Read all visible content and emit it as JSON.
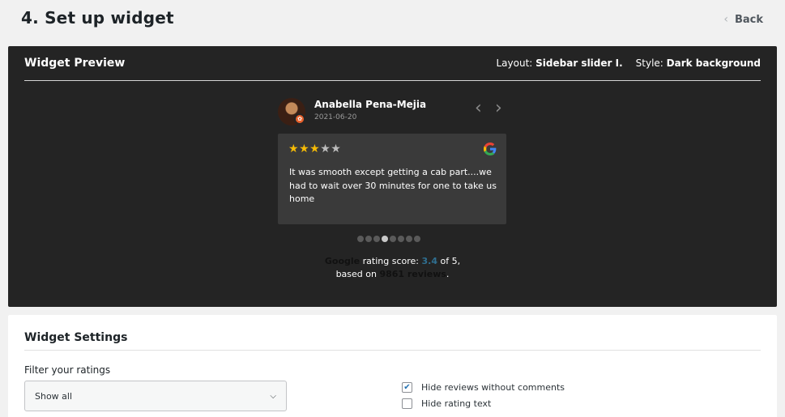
{
  "page": {
    "title": "4. Set up widget",
    "back_label": "Back"
  },
  "preview": {
    "title": "Widget Preview",
    "layout_label": "Layout:",
    "layout_value": "Sidebar slider I.",
    "style_label": "Style:",
    "style_value": "Dark background",
    "review": {
      "name": "Anabella Pena-Mejia",
      "date": "2021-06-20",
      "rating": 3,
      "max_rating": 5,
      "text": "It was smooth except getting a cab part....we had to wait over 30 minutes for one to take us home"
    },
    "pagination": {
      "count": 8,
      "active_index": 3
    },
    "summary": {
      "source": "Google",
      "label": "rating score:",
      "score": "3.4",
      "of": "of 5,",
      "based_on": "based on",
      "reviews": "9861 reviews",
      "end": "."
    },
    "colors": {
      "star_on": "#f6bb06",
      "star_off": "#bdbdbd",
      "panel_bg": "#242424",
      "card_bg": "#3a3a3a"
    }
  },
  "settings": {
    "title": "Widget Settings",
    "filter_label": "Filter your ratings",
    "filter_value": "Show all",
    "options": [
      {
        "label": "Hide reviews without comments",
        "checked": true
      },
      {
        "label": "Hide rating text",
        "checked": false
      }
    ]
  }
}
